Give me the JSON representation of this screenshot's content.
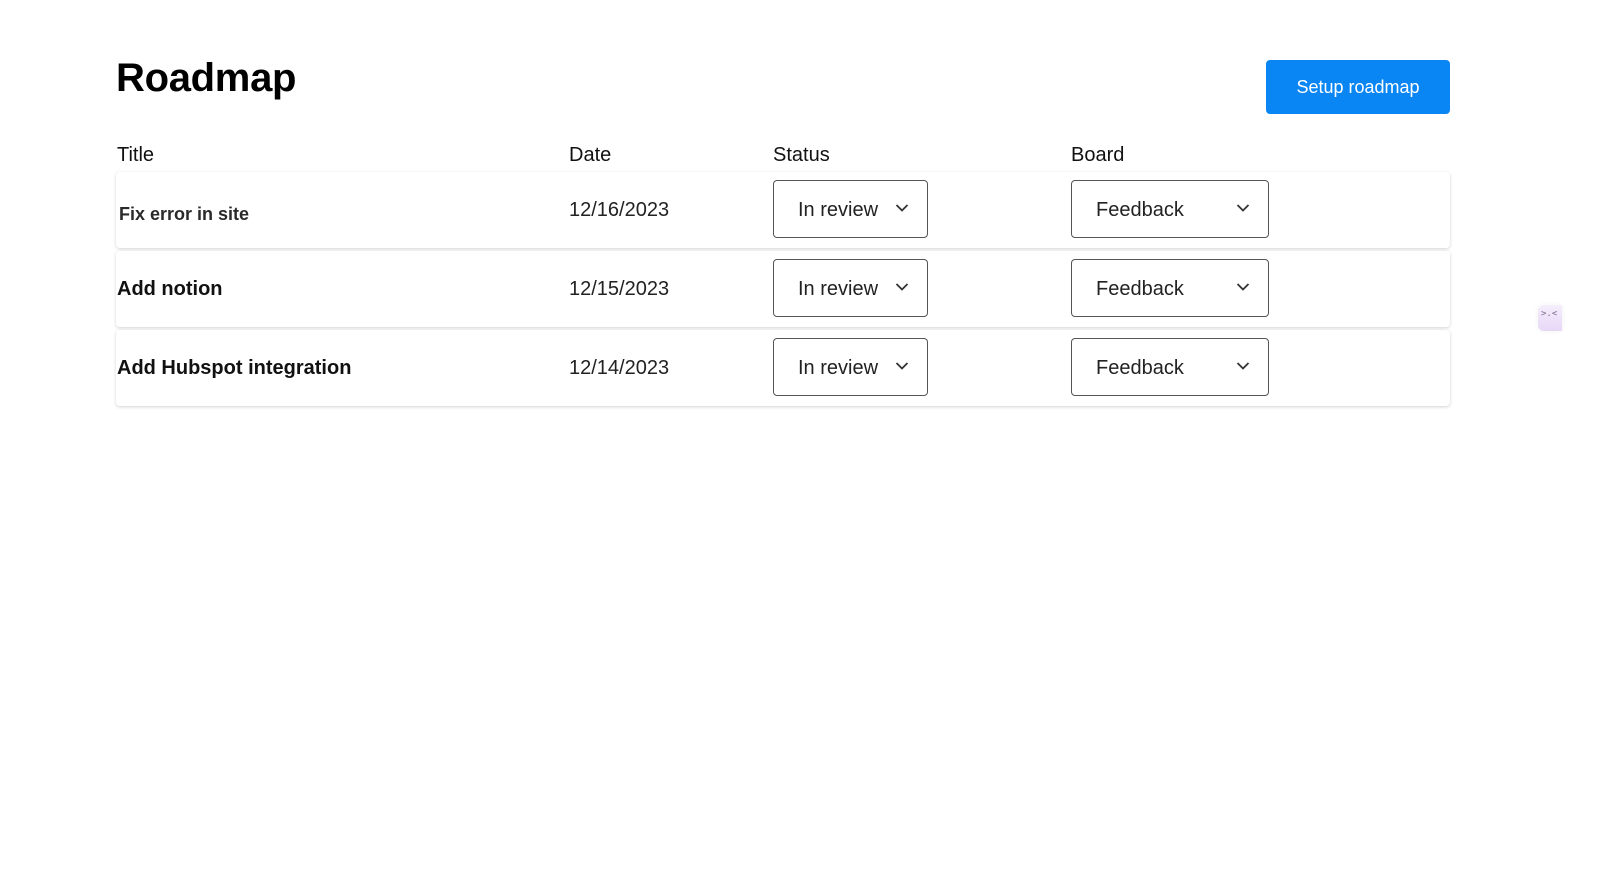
{
  "header": {
    "title": "Roadmap",
    "setup_button_label": "Setup roadmap"
  },
  "table": {
    "columns": [
      "Title",
      "Date",
      "Status",
      "Board"
    ],
    "rows": [
      {
        "title": "Fix error in site",
        "date": "12/16/2023",
        "status": "In review",
        "board": "Feedback"
      },
      {
        "title": "Add notion",
        "date": "12/15/2023",
        "status": "In review",
        "board": "Feedback"
      },
      {
        "title": "Add Hubspot integration",
        "date": "12/14/2023",
        "status": "In review",
        "board": "Feedback"
      }
    ]
  },
  "side_widget": {
    "glyph": ">.<",
    "icon": "chat-face-icon"
  },
  "colors": {
    "accent": "#0a85f4",
    "background": "#ffffff",
    "text": "#111111"
  }
}
